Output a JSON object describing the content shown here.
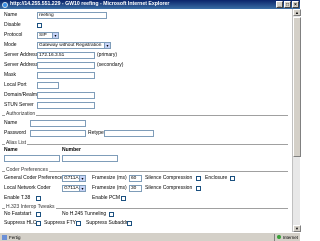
{
  "window": {
    "title": "http://14.255.551.229 - GW10 reefing - Microsoft Internet Explorer",
    "minimize": "_",
    "maximize": "□",
    "close": "×"
  },
  "form": {
    "name": {
      "label": "Name",
      "value": "reefing"
    },
    "disable": {
      "label": "Disable"
    },
    "protocol": {
      "label": "Protocol",
      "value": "SIP"
    },
    "mode": {
      "label": "Mode",
      "value": "Gateway without Registration"
    },
    "server_address_primary": {
      "label": "Server Address",
      "value": "172.16.3.51",
      "suffix": "(primary)"
    },
    "server_address_secondary": {
      "label": "Server Address",
      "value": "",
      "suffix": "(secondary)"
    },
    "mask": {
      "label": "Mask",
      "value": ""
    },
    "local_port": {
      "label": "Local Port",
      "value": ""
    },
    "domain_realm": {
      "label": "Domain/Realm",
      "value": ""
    },
    "stun_server": {
      "label": "STUN Server",
      "value": ""
    }
  },
  "authorization": {
    "section_title": "Authorization",
    "name_label": "Name",
    "password_label": "Password",
    "retype_label": "Retype"
  },
  "alias_list": {
    "section_title": "Alias List",
    "col_name": "Name",
    "col_number": "Number"
  },
  "coder_prefs": {
    "section_title": "Coder Preferences",
    "general_label": "General Coder Preference",
    "general_value": "G711A",
    "local_label": "Local Network Coder",
    "local_value": "G711A",
    "framesize_label": "Framesize (ms)",
    "general_framesize": "60",
    "local_framesize": "30",
    "silence_label": "Silence Compression",
    "enclosure_label": "Enclosure",
    "t38_label": "Enable T.38",
    "pcm_label": "Enable PCM"
  },
  "h323": {
    "section_title": "H.323 Interop Tweaks",
    "no_faststart": "No Faststart",
    "no_h245": "No H.245 Tunneling",
    "suppress_hlc": "Suppress HLC",
    "suppress_fty": "Suppress FTY",
    "suppress_subaddr": "Suppress Subaddr"
  },
  "status": {
    "text": "Fertig",
    "zone": "Internet"
  }
}
